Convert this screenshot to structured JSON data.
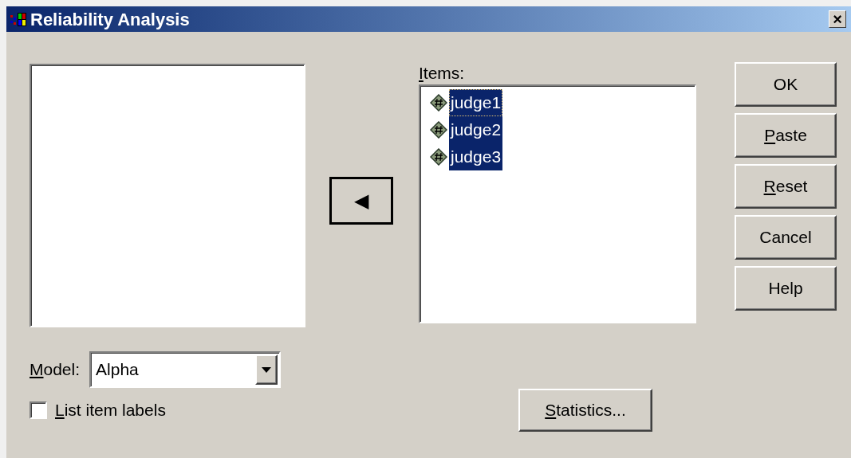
{
  "window": {
    "title": "Reliability Analysis",
    "close": "×"
  },
  "move_button": {
    "glyph": "◀"
  },
  "items_list": {
    "label": {
      "accel": "I",
      "text": "tems:"
    },
    "items": [
      {
        "name": "judge1",
        "selected": true,
        "focused": true
      },
      {
        "name": "judge2",
        "selected": true,
        "focused": false
      },
      {
        "name": "judge3",
        "selected": true,
        "focused": false
      }
    ]
  },
  "buttons": [
    {
      "text": "OK"
    },
    {
      "accel": "P",
      "text": "aste"
    },
    {
      "accel": "R",
      "text": "eset"
    },
    {
      "text": "Cancel"
    },
    {
      "text": "Help"
    }
  ],
  "model": {
    "label": {
      "accel": "M",
      "text": "odel:"
    },
    "value": "Alpha"
  },
  "list_item_labels": {
    "label": {
      "accel": "L",
      "text": "ist item labels"
    },
    "checked": false
  },
  "statistics_button": {
    "accel": "S",
    "text": "tatistics..."
  }
}
